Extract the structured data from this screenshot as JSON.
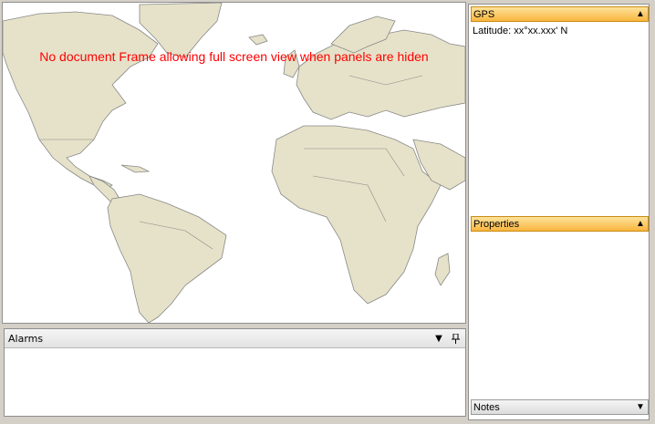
{
  "map": {
    "banner": "No document Frame allowing full screen view when panels are hiden",
    "land_color": "#e6e2c9",
    "border_color": "#888888"
  },
  "alarms": {
    "title": "Alarms",
    "dropdown_icon": "dropdown-arrow-icon",
    "pin_icon": "pin-icon"
  },
  "gps": {
    "title": "GPS",
    "latitude_text": "Latitude: xx°xx.xxx' N"
  },
  "properties": {
    "title": "Properties"
  },
  "notes": {
    "title": "Notes"
  },
  "colors": {
    "panel_header_orange": "#f9b53e",
    "banner_red": "#ff0000"
  }
}
